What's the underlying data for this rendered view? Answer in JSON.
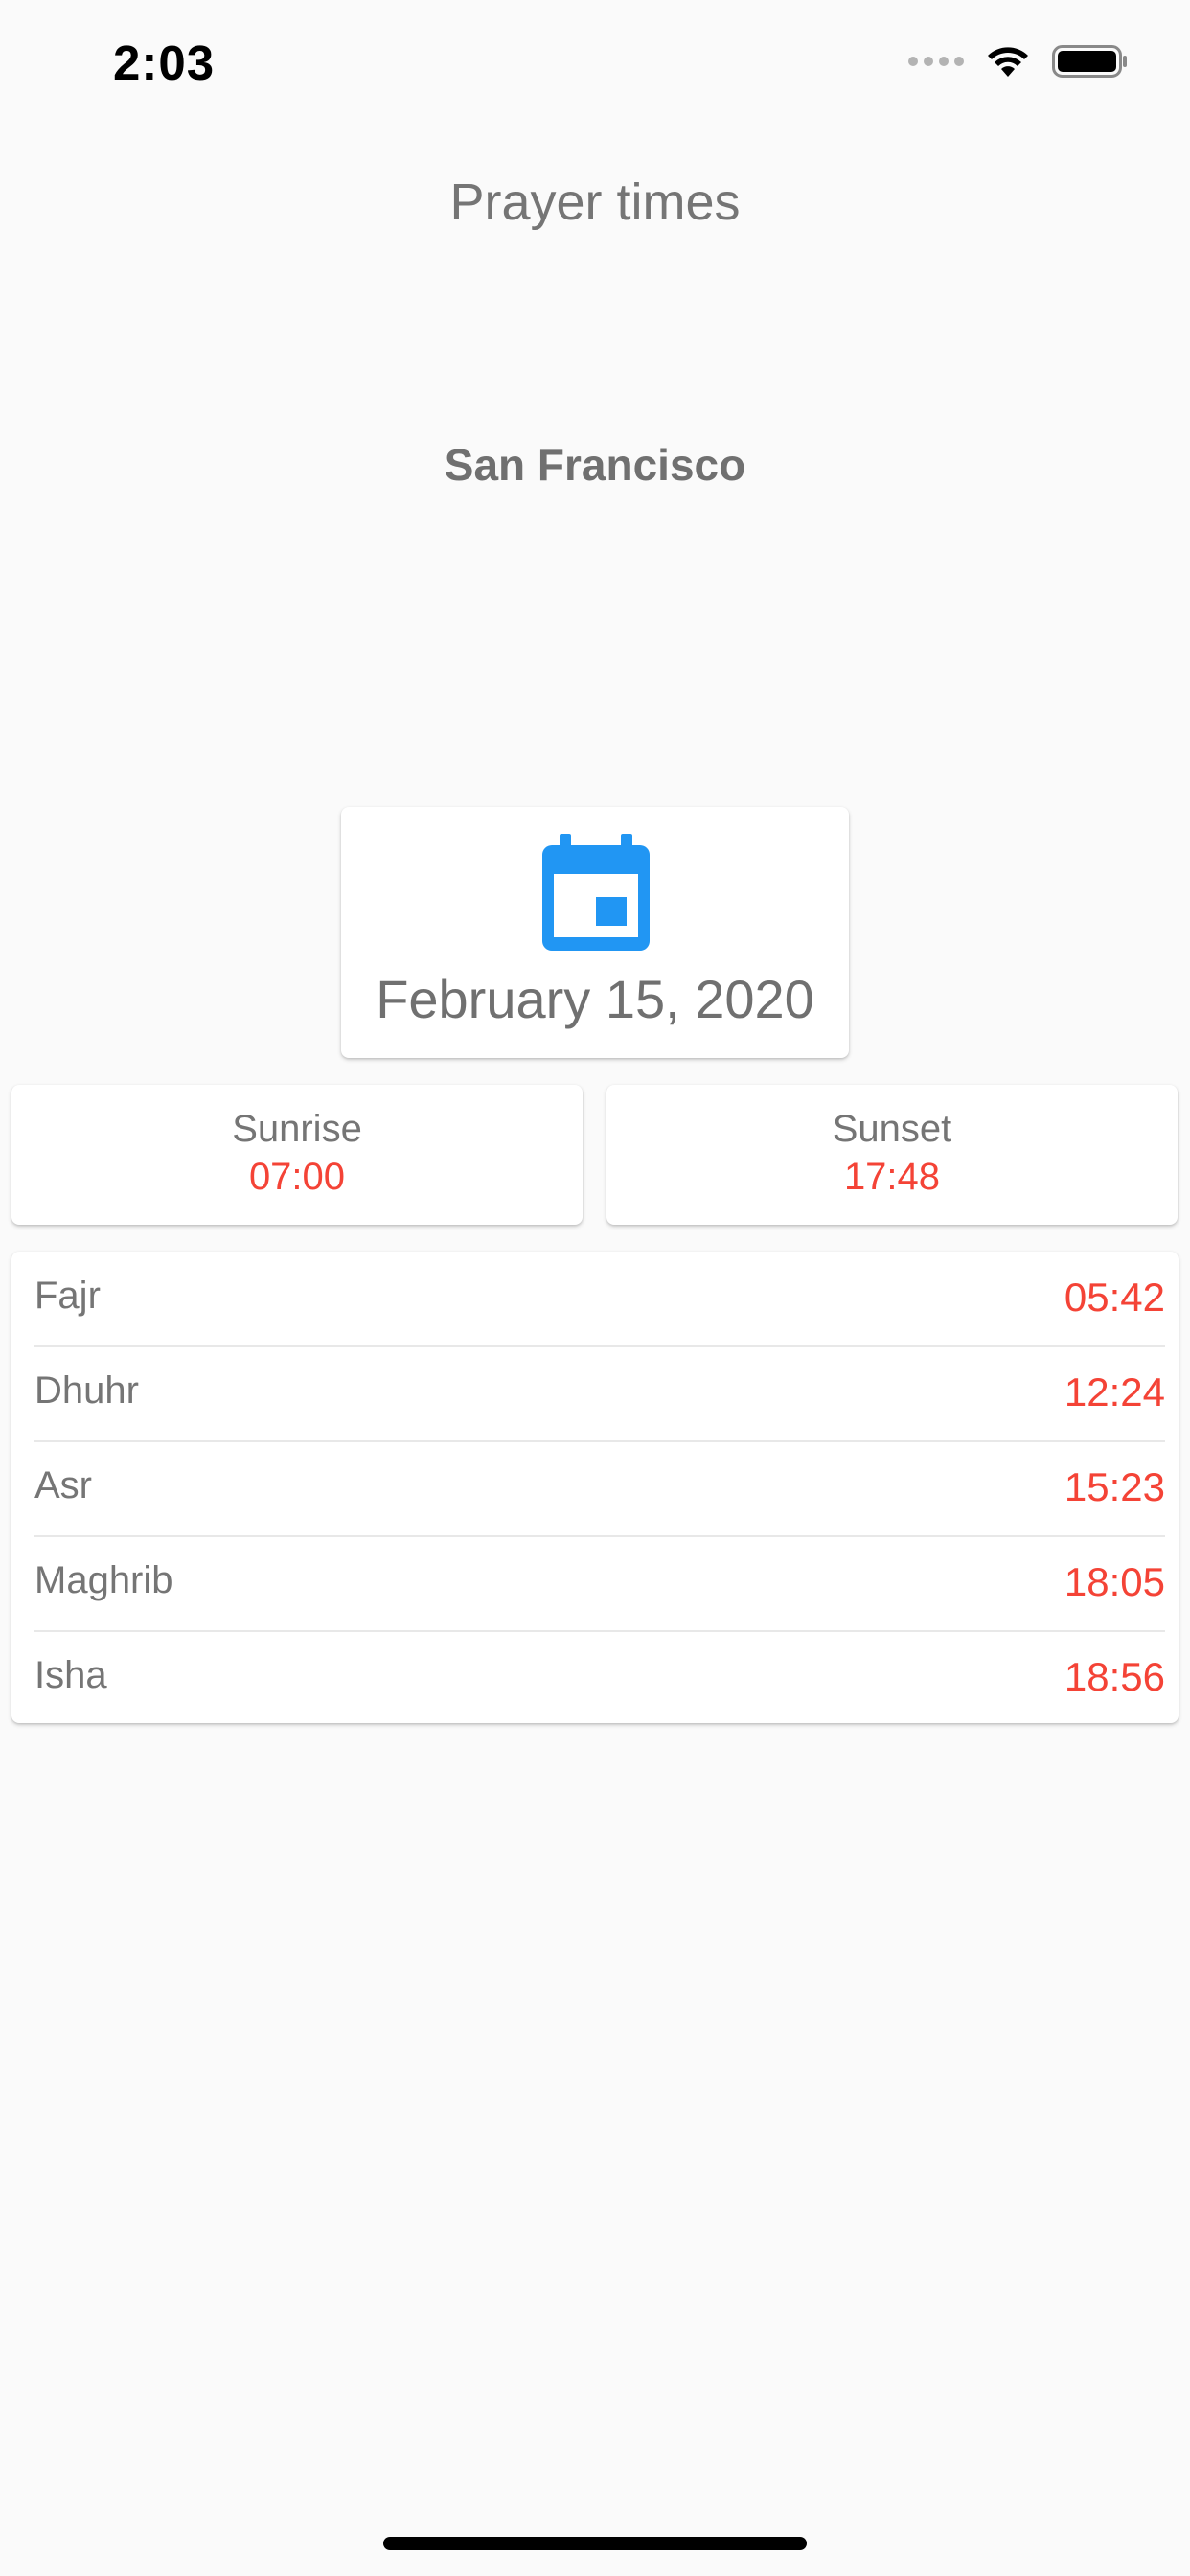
{
  "status_bar": {
    "time": "2:03",
    "signal_icon": "signal-dots-icon",
    "wifi_icon": "wifi-icon",
    "battery_icon": "battery-icon"
  },
  "header": {
    "title": "Prayer times"
  },
  "location": {
    "city": "San Francisco"
  },
  "date_card": {
    "icon": "calendar-icon",
    "date": "February 15, 2020"
  },
  "sun": {
    "sunrise_label": "Sunrise",
    "sunrise_time": "07:00",
    "sunset_label": "Sunset",
    "sunset_time": "17:48"
  },
  "prayers": [
    {
      "name": "Fajr",
      "time": "05:42"
    },
    {
      "name": "Dhuhr",
      "time": "12:24"
    },
    {
      "name": "Asr",
      "time": "15:23"
    },
    {
      "name": "Maghrib",
      "time": "18:05"
    },
    {
      "name": "Isha",
      "time": "18:56"
    }
  ],
  "colors": {
    "accent_blue": "#2196f3",
    "time_red": "#f44336",
    "text_gray": "#757575",
    "background": "#fafafa"
  }
}
